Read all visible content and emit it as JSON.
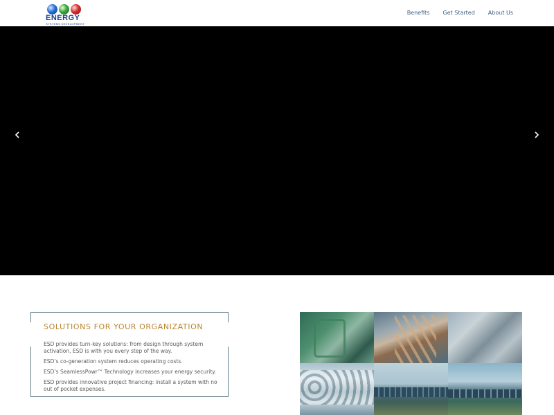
{
  "header": {
    "logo_text": "ENERGY",
    "logo_subtext": "SYSTEMS DEVELOPMENT",
    "nav": [
      {
        "label": "Benefits"
      },
      {
        "label": "Get Started"
      },
      {
        "label": "About Us"
      }
    ]
  },
  "slider": {
    "prev_icon": "chevron-left-icon",
    "next_icon": "chevron-right-icon"
  },
  "solutions": {
    "title": "SOLUTIONS FOR YOUR ORGANIZATION",
    "paragraphs": [
      "ESD provides turn-key solutions: from design through system activation, ESD is with you every step of the way.",
      "ESD’s co-generation system reduces operating costs.",
      "ESD’s SeamlessPowr™ Technology increases your energy security.",
      "ESD provides innovative project financing: install a system with no out of pocket expenses."
    ]
  },
  "gallery": {
    "images": [
      "generator-equipment",
      "copper-pipes",
      "gas-meters",
      "pipe-rolls",
      "solar-array-field",
      "solar-panels-sky"
    ]
  }
}
